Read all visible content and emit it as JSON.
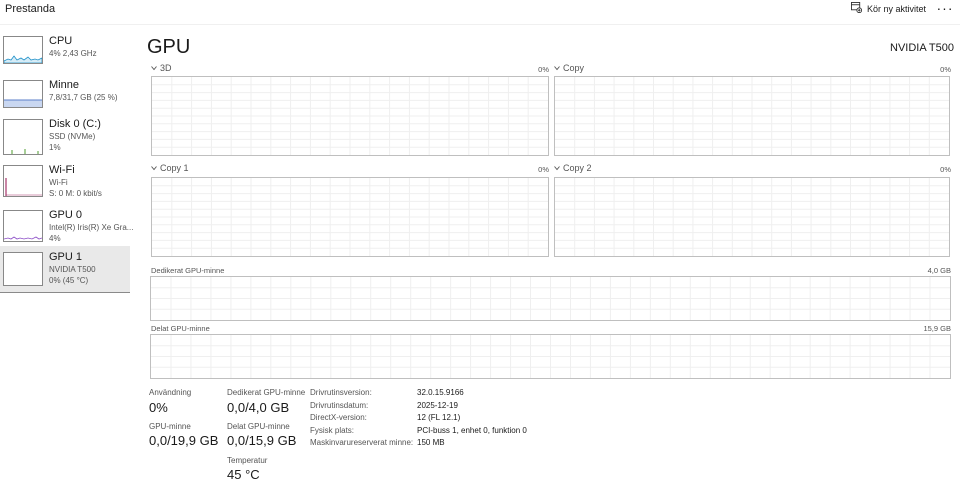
{
  "app": {
    "title": "Prestanda"
  },
  "toolbar": {
    "run_new_task": "Kör ny aktivitet",
    "more": "···"
  },
  "sidebar": {
    "items": [
      {
        "name": "CPU",
        "lines": [
          "4%  2,43 GHz"
        ],
        "color": "#1e90c8"
      },
      {
        "name": "Minne",
        "lines": [
          "7,8/31,7 GB (25 %)"
        ],
        "color": "#5b7fc9"
      },
      {
        "name": "Disk 0 (C:)",
        "lines": [
          "SSD (NVMe)",
          "1%"
        ],
        "color": "#4f9d2f"
      },
      {
        "name": "Wi-Fi",
        "lines": [
          "Wi-Fi",
          "S: 0  M: 0 kbit/s"
        ],
        "color": "#a7356a"
      },
      {
        "name": "GPU 0",
        "lines": [
          "Intel(R) Iris(R) Xe Gra...",
          "4%"
        ],
        "color": "#8a4bc6"
      },
      {
        "name": "GPU 1",
        "lines": [
          "NVIDIA T500",
          "0%  (45 °C)"
        ],
        "color": "#8a4bc6",
        "selected": true
      }
    ]
  },
  "main": {
    "title": "GPU",
    "device_name": "NVIDIA T500",
    "engines": [
      {
        "label": "3D",
        "percent": "0%"
      },
      {
        "label": "Copy",
        "percent": "0%"
      },
      {
        "label": "Copy 1",
        "percent": "0%"
      },
      {
        "label": "Copy 2",
        "percent": "0%"
      }
    ],
    "dedicated_memory": {
      "label": "Dedikerat GPU-minne",
      "max": "4,0 GB"
    },
    "shared_memory": {
      "label": "Delat GPU-minne",
      "max": "15,9 GB"
    }
  },
  "stats": {
    "usage": {
      "label": "Användning",
      "value": "0%"
    },
    "dedicated": {
      "label": "Dedikerat GPU-minne",
      "value": "0,0/4,0 GB"
    },
    "gpu_memory": {
      "label": "GPU-minne",
      "value": "0,0/19,9 GB"
    },
    "shared": {
      "label": "Delat GPU-minne",
      "value": "0,0/15,9 GB"
    },
    "temperature": {
      "label": "Temperatur",
      "value": "45 °C"
    }
  },
  "info": [
    {
      "key": "Drivrutinsversion:",
      "value": "32.0.15.9166"
    },
    {
      "key": "Drivrutinsdatum:",
      "value": "2025-12-19"
    },
    {
      "key": "DirectX-version:",
      "value": "12 (FL 12.1)"
    },
    {
      "key": "Fysisk plats:",
      "value": "PCI-buss 1, enhet 0, funktion 0"
    },
    {
      "key": "Maskinvarureserverat minne:",
      "value": "150 MB"
    }
  ]
}
